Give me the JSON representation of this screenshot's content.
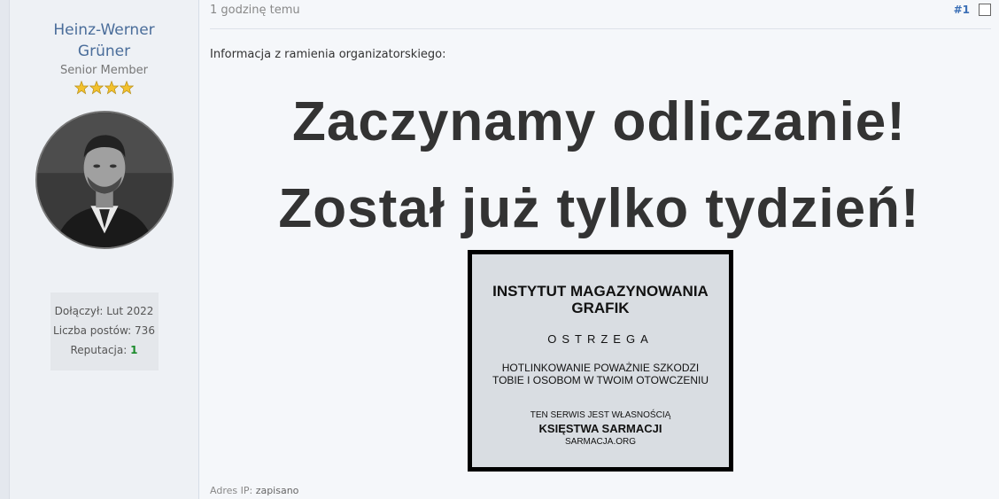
{
  "user": {
    "name": "Heinz-Werner Grüner",
    "rank_title": "Senior Member",
    "stars": 4,
    "joined_label": "Dołączył:",
    "joined_value": "Lut 2022",
    "posts_label": "Liczba postów:",
    "posts_value": "736",
    "reputation_label": "Reputacja:",
    "reputation_value": "1"
  },
  "post": {
    "date": "1 godzinę temu",
    "number": "#1",
    "intro": "Informacja z ramienia organizatorskiego:",
    "headline_line1": "Zaczynamy odliczanie!",
    "headline_line2": "Został już tylko tydzień!",
    "ip_label": "Adres IP:",
    "ip_value": "zapisano"
  },
  "hotlink_image": {
    "title": "INSTYTUT MAGAZYNOWANIA GRAFIK",
    "warning": "OSTRZEGA",
    "message_line1": "HOTLINKOWANIE POWAŻNIE SZKODZI",
    "message_line2": "TOBIE I OSOBOM W TWOIM OTOWCZENIU",
    "ownership": "TEN SERWIS JEST WŁASNOŚCIĄ",
    "owner": "KSIĘSTWA SARMACJI",
    "site": "SARMACJA.ORG"
  },
  "colors": {
    "username": "#4a6d9a",
    "post_number": "#3b6fb6",
    "reputation": "#1a8a2a",
    "star": "#f2c12e"
  }
}
